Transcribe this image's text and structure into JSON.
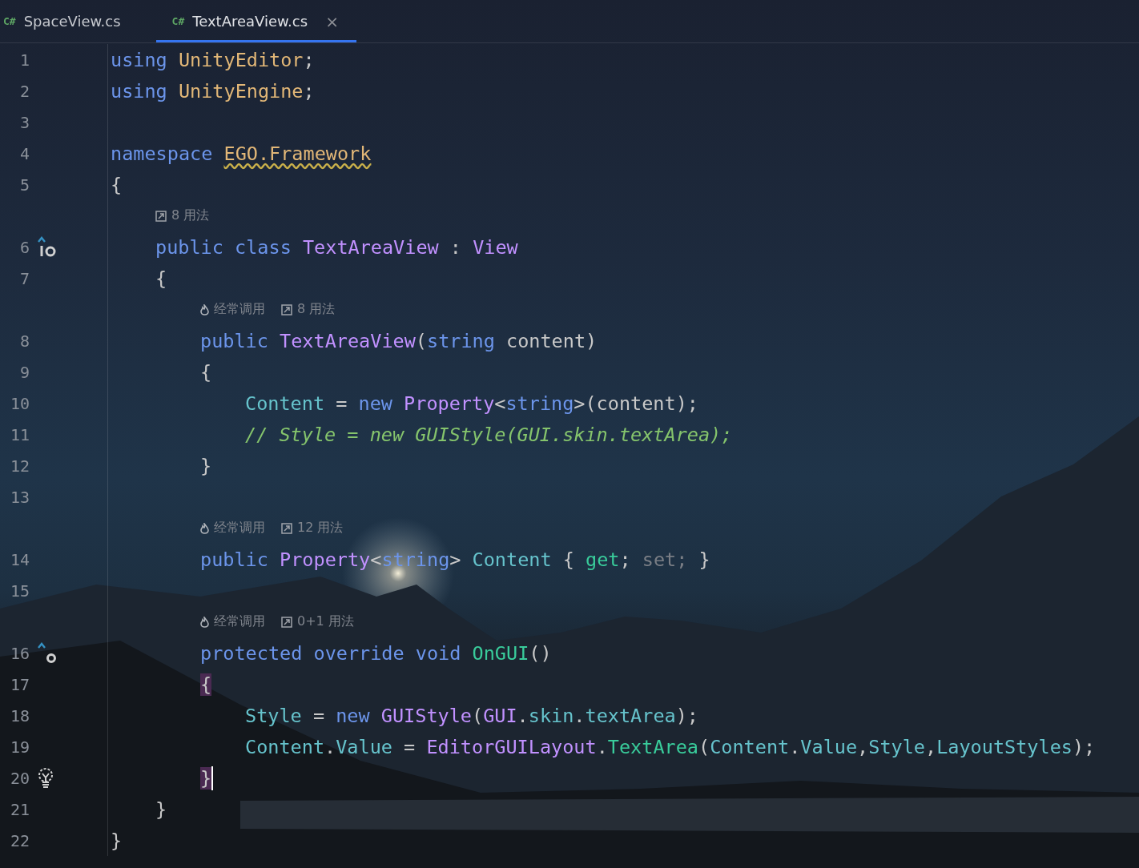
{
  "tabs": [
    {
      "icon_text": "C#",
      "label": "SpaceView.cs",
      "selected": false
    },
    {
      "icon_text": "C#",
      "label": "TextAreaView.cs",
      "selected": true,
      "close": "×"
    }
  ],
  "lines": [
    {
      "kind": "code",
      "number": "1",
      "tokens": [
        {
          "kind": "keyword",
          "text": "using "
        },
        {
          "kind": "namespace",
          "text": "UnityEditor"
        },
        {
          "kind": "plain",
          "text": ";"
        }
      ]
    },
    {
      "kind": "code",
      "number": "2",
      "tokens": [
        {
          "kind": "keyword",
          "text": "using "
        },
        {
          "kind": "namespace",
          "text": "UnityEngine"
        },
        {
          "kind": "plain",
          "text": ";"
        }
      ]
    },
    {
      "kind": "code",
      "number": "3"
    },
    {
      "kind": "code",
      "number": "4",
      "tokens": [
        {
          "kind": "keyword",
          "text": "namespace "
        },
        {
          "kind": "namespace",
          "text": "EGO.Framework",
          "warning": true
        }
      ]
    },
    {
      "kind": "code",
      "number": "5",
      "tokens": [
        {
          "kind": "plain",
          "text": "{"
        }
      ],
      "children": [
        {
          "kind": "hint",
          "items": [
            {
              "kind": "usages",
              "text": "8 用法"
            }
          ]
        },
        {
          "kind": "code",
          "number": "6",
          "gutter": {
            "kind": "implemented"
          },
          "tokens": [
            {
              "kind": "keyword",
              "text": "public class "
            },
            {
              "kind": "type",
              "text": "TextAreaView"
            },
            {
              "kind": "plain",
              "text": " : "
            },
            {
              "kind": "type",
              "text": "View"
            }
          ]
        },
        {
          "kind": "code",
          "number": "7",
          "tokens": [
            {
              "kind": "plain",
              "text": "{"
            }
          ],
          "children": [
            {
              "kind": "hint",
              "items": [
                {
                  "kind": "hot",
                  "text": "经常调用"
                },
                {
                  "kind": "usages",
                  "text": "8 用法"
                }
              ]
            },
            {
              "kind": "code",
              "number": "8",
              "tokens": [
                {
                  "kind": "keyword",
                  "text": "public "
                },
                {
                  "kind": "type",
                  "text": "TextAreaView"
                },
                {
                  "kind": "plain",
                  "text": "("
                },
                {
                  "kind": "keyword",
                  "text": "string"
                },
                {
                  "kind": "plain",
                  "text": " content)"
                }
              ]
            },
            {
              "kind": "code",
              "number": "9",
              "tokens": [
                {
                  "kind": "plain",
                  "text": "{"
                }
              ],
              "children": [
                {
                  "kind": "code",
                  "number": "10",
                  "tokens": [
                    {
                      "kind": "property",
                      "text": "Content"
                    },
                    {
                      "kind": "plain",
                      "text": " = "
                    },
                    {
                      "kind": "keyword",
                      "text": "new "
                    },
                    {
                      "kind": "type",
                      "text": "Property"
                    },
                    {
                      "kind": "plain",
                      "text": "<"
                    },
                    {
                      "kind": "keyword",
                      "text": "string"
                    },
                    {
                      "kind": "plain",
                      "text": ">(content);"
                    }
                  ]
                },
                {
                  "kind": "code",
                  "number": "11",
                  "tokens": [
                    {
                      "kind": "comment",
                      "text": "// Style = new GUIStyle(GUI.skin.textArea);"
                    }
                  ]
                }
              ]
            },
            {
              "kind": "code",
              "number": "12",
              "tokens": [
                {
                  "kind": "plain",
                  "text": "}"
                }
              ]
            },
            {
              "kind": "code",
              "number": "13"
            },
            {
              "kind": "hint",
              "items": [
                {
                  "kind": "hot",
                  "text": "经常调用"
                },
                {
                  "kind": "usages",
                  "text": "12 用法"
                }
              ]
            },
            {
              "kind": "code",
              "number": "14",
              "tokens": [
                {
                  "kind": "keyword",
                  "text": "public "
                },
                {
                  "kind": "type",
                  "text": "Property"
                },
                {
                  "kind": "plain",
                  "text": "<"
                },
                {
                  "kind": "keyword",
                  "text": "string"
                },
                {
                  "kind": "plain",
                  "text": "> "
                },
                {
                  "kind": "property",
                  "text": "Content"
                },
                {
                  "kind": "plain",
                  "text": " { "
                },
                {
                  "kind": "method",
                  "text": "get"
                },
                {
                  "kind": "plain",
                  "text": "; "
                },
                {
                  "kind": "inactive",
                  "text": "set;"
                },
                {
                  "kind": "plain",
                  "text": " }"
                }
              ]
            },
            {
              "kind": "code",
              "number": "15"
            },
            {
              "kind": "hint",
              "items": [
                {
                  "kind": "hot",
                  "text": "经常调用"
                },
                {
                  "kind": "usages",
                  "text": "0+1 用法"
                }
              ]
            },
            {
              "kind": "code",
              "number": "16",
              "gutter": {
                "kind": "overrides"
              },
              "tokens": [
                {
                  "kind": "keyword",
                  "text": "protected override void "
                },
                {
                  "kind": "method",
                  "text": "OnGUI"
                },
                {
                  "kind": "plain",
                  "text": "()"
                }
              ]
            },
            {
              "kind": "code",
              "number": "17",
              "tokens": [
                {
                  "kind": "plain",
                  "text": "{",
                  "matched": true
                }
              ],
              "children": [
                {
                  "kind": "code",
                  "number": "18",
                  "tokens": [
                    {
                      "kind": "property",
                      "text": "Style"
                    },
                    {
                      "kind": "plain",
                      "text": " = "
                    },
                    {
                      "kind": "keyword",
                      "text": "new "
                    },
                    {
                      "kind": "type",
                      "text": "GUIStyle"
                    },
                    {
                      "kind": "plain",
                      "text": "("
                    },
                    {
                      "kind": "type",
                      "text": "GUI"
                    },
                    {
                      "kind": "plain",
                      "text": "."
                    },
                    {
                      "kind": "property",
                      "text": "skin"
                    },
                    {
                      "kind": "plain",
                      "text": "."
                    },
                    {
                      "kind": "property",
                      "text": "textArea"
                    },
                    {
                      "kind": "plain",
                      "text": ");"
                    }
                  ]
                },
                {
                  "kind": "code",
                  "number": "19",
                  "tokens": [
                    {
                      "kind": "property",
                      "text": "Content"
                    },
                    {
                      "kind": "plain",
                      "text": "."
                    },
                    {
                      "kind": "property",
                      "text": "Value"
                    },
                    {
                      "kind": "plain",
                      "text": " = "
                    },
                    {
                      "kind": "type",
                      "text": "EditorGUILayout"
                    },
                    {
                      "kind": "plain",
                      "text": "."
                    },
                    {
                      "kind": "method",
                      "text": "TextArea"
                    },
                    {
                      "kind": "plain",
                      "text": "("
                    },
                    {
                      "kind": "property",
                      "text": "Content"
                    },
                    {
                      "kind": "plain",
                      "text": "."
                    },
                    {
                      "kind": "property",
                      "text": "Value"
                    },
                    {
                      "kind": "plain",
                      "text": ","
                    },
                    {
                      "kind": "property",
                      "text": "Style"
                    },
                    {
                      "kind": "plain",
                      "text": ","
                    },
                    {
                      "kind": "property",
                      "text": "LayoutStyles"
                    },
                    {
                      "kind": "plain",
                      "text": ");"
                    }
                  ]
                }
              ]
            },
            {
              "kind": "code",
              "number": "20",
              "gutter": {
                "kind": "bulb"
              },
              "caret": true,
              "tokens": [
                {
                  "kind": "plain",
                  "text": "}",
                  "matched": true
                }
              ]
            }
          ]
        },
        {
          "kind": "code",
          "number": "21",
          "tokens": [
            {
              "kind": "plain",
              "text": "}"
            }
          ]
        }
      ]
    },
    {
      "kind": "code",
      "number": "22",
      "tokens": [
        {
          "kind": "plain",
          "text": "}"
        }
      ]
    }
  ]
}
